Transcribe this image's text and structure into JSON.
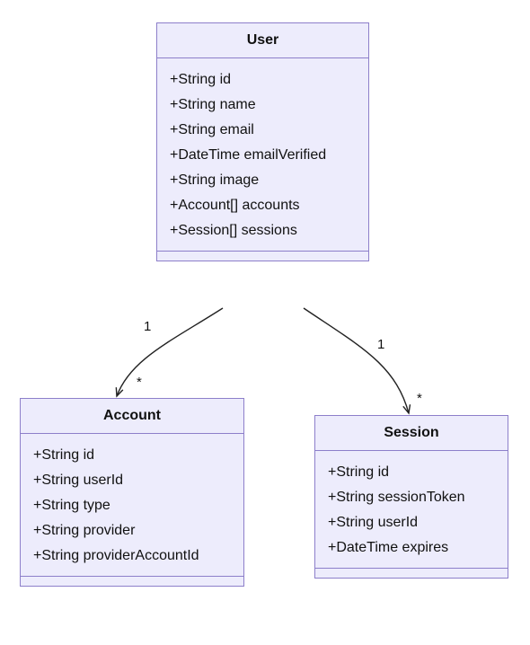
{
  "diagram": {
    "type": "uml-class-diagram",
    "classes": {
      "user": {
        "name": "User",
        "attributes": [
          "+String id",
          "+String name",
          "+String email",
          "+DateTime emailVerified",
          "+String image",
          "+Account[] accounts",
          "+Session[] sessions"
        ]
      },
      "account": {
        "name": "Account",
        "attributes": [
          "+String id",
          "+String userId",
          "+String type",
          "+String provider",
          "+String providerAccountId"
        ]
      },
      "session": {
        "name": "Session",
        "attributes": [
          "+String id",
          "+String sessionToken",
          "+String userId",
          "+DateTime expires"
        ]
      }
    },
    "relationships": [
      {
        "from": "user",
        "to": "account",
        "fromMultiplicity": "1",
        "toMultiplicity": "*"
      },
      {
        "from": "user",
        "to": "session",
        "fromMultiplicity": "1",
        "toMultiplicity": "*"
      }
    ]
  }
}
